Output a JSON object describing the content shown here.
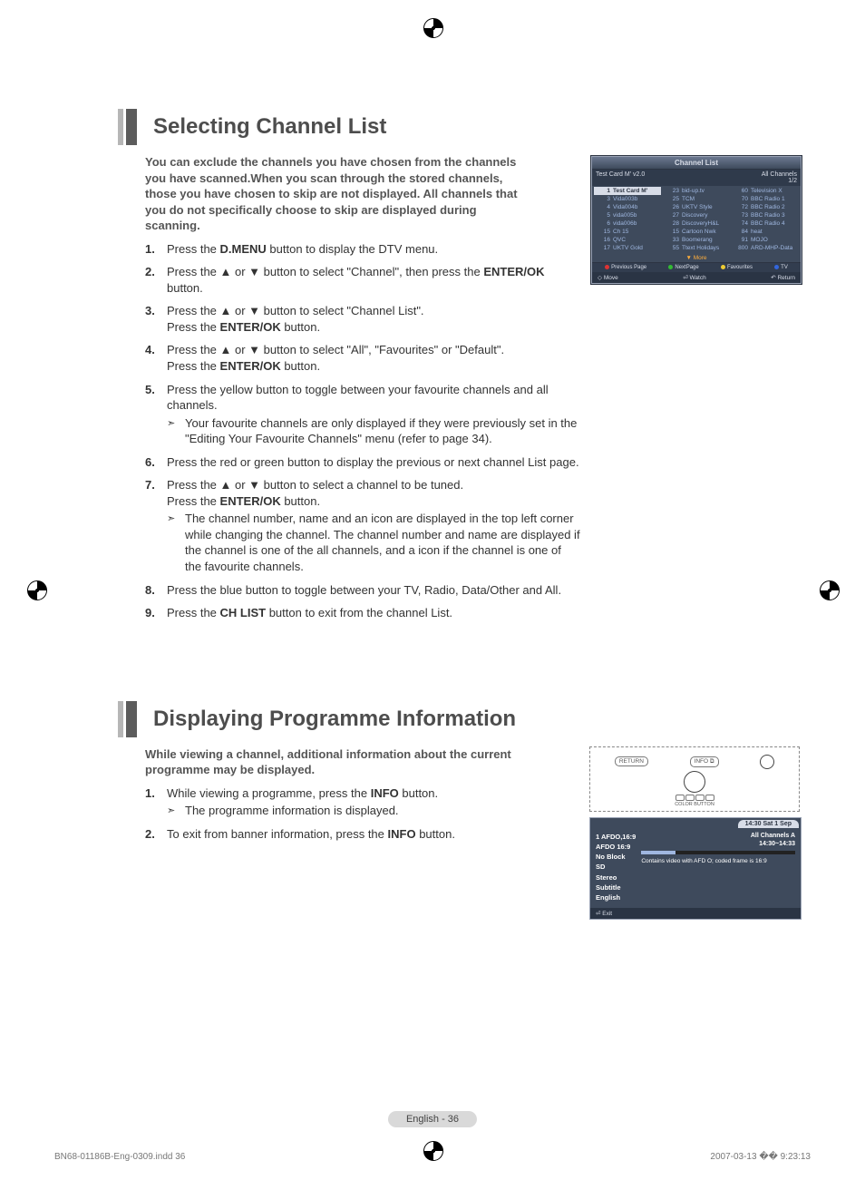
{
  "section1": {
    "title": "Selecting Channel List",
    "intro": "You can exclude the channels you have chosen from the channels you have scanned.When you scan through the stored channels, those you have chosen to skip are not displayed. All channels that you do not specifically choose to skip are displayed during scanning.",
    "steps": {
      "s1a": "Press the ",
      "s1b": "D.MENU",
      "s1c": " button to display the DTV menu.",
      "s2a": "Press the ▲ or ▼ button to select \"Channel\", then press the ",
      "s2b": "ENTER/OK",
      "s2c": " button.",
      "s3a": "Press the ▲ or ▼ button to select \"Channel List\".",
      "s3b": "Press the ",
      "s3c": "ENTER/OK",
      "s3d": " button.",
      "s4a": "Press the ▲ or ▼ button to select \"All\", \"Favourites\" or \"Default\".",
      "s4b": "Press the ",
      "s4c": "ENTER/OK",
      "s4d": " button.",
      "s5a": "Press the yellow button to toggle between your favourite channels and all channels.",
      "s5sub": "Your favourite channels are only displayed if they were previously set in the \"Editing Your Favourite Channels\" menu (refer to page 34).",
      "s6": "Press the red or green button to display the previous or next channel List page.",
      "s7a": "Press the ▲ or ▼ button to select a channel to be tuned.",
      "s7b": "Press the ",
      "s7c": "ENTER/OK",
      "s7d": " button.",
      "s7sub": "The channel number, name and an icon are displayed in the top left corner while changing the channel. The channel number and name are displayed if the channel is one of the all channels, and a  icon if the channel is one of the favourite channels.",
      "s8": "Press the blue button to toggle between your TV, Radio, Data/Other and All.",
      "s9a": "Press the ",
      "s9b": "CH LIST",
      "s9c": " button to exit from the channel List."
    }
  },
  "osd1": {
    "title": "Channel List",
    "topleft": "Test Card M' v2.0",
    "topright1": "All Channels",
    "topright2": "1/2",
    "cols": [
      [
        {
          "n": "1",
          "t": "Test Card M'",
          "sel": true
        },
        {
          "n": "3",
          "t": "Vida003b"
        },
        {
          "n": "4",
          "t": "Vida004b"
        },
        {
          "n": "5",
          "t": "vida005b"
        },
        {
          "n": "6",
          "t": "vida006b"
        },
        {
          "n": "15",
          "t": "Ch 15"
        },
        {
          "n": "16",
          "t": "QVC"
        },
        {
          "n": "17",
          "t": "UKTV Gold"
        }
      ],
      [
        {
          "n": "23",
          "t": "bid-up.tv"
        },
        {
          "n": "25",
          "t": "TCM"
        },
        {
          "n": "26",
          "t": "UKTV Style"
        },
        {
          "n": "27",
          "t": "Discovery"
        },
        {
          "n": "28",
          "t": "DiscoveryH&L"
        },
        {
          "n": "15",
          "t": "Cartoon Nwk"
        },
        {
          "n": "33",
          "t": "Boomerang"
        },
        {
          "n": "55",
          "t": "Ttext Holidays"
        }
      ],
      [
        {
          "n": "60",
          "t": "Television X"
        },
        {
          "n": "70",
          "t": "BBC Radio 1"
        },
        {
          "n": "72",
          "t": "BBC Radio 2"
        },
        {
          "n": "73",
          "t": "BBC Radio 3"
        },
        {
          "n": "74",
          "t": "BBC Radio 4"
        },
        {
          "n": "84",
          "t": "heat"
        },
        {
          "n": "91",
          "t": "MOJO"
        },
        {
          "n": "800",
          "t": "ARD-MHP-Data"
        }
      ]
    ],
    "more": "More",
    "foot": {
      "prev": "Previous Page",
      "next": "NextPage",
      "fav": "Favourites",
      "tv": "TV"
    },
    "foot2": {
      "move": "Move",
      "watch": "Watch",
      "ret": "Return"
    }
  },
  "section2": {
    "title": "Displaying Programme Information",
    "intro": "While viewing a channel, additional information about the current programme may be displayed.",
    "steps": {
      "s1a": "While viewing a programme, press the ",
      "s1b": "INFO",
      "s1c": " button.",
      "s1sub": "The programme information is displayed.",
      "s2a": "To exit from banner information, press the ",
      "s2b": "INFO",
      "s2c": " button."
    }
  },
  "remote": {
    "return": "RETURN",
    "info": "INFO",
    "color": "COLOR BUTTON"
  },
  "osd2": {
    "time": "14:30 Sat 1 Sep",
    "chip1": "All Channels   A",
    "chip2": "14:30~14:33",
    "left": [
      "1 AFDO,16:9",
      "AFDO 16:9",
      "No Block",
      "SD",
      "Stereo",
      "Subtitle",
      "English"
    ],
    "desc": "Contains video with AFD O; coded frame is 16:9",
    "exit": "Exit"
  },
  "footer": {
    "page": "English - 36",
    "left": "BN68-01186B-Eng-0309.indd   36",
    "right": "2007-03-13   �� 9:23:13"
  }
}
